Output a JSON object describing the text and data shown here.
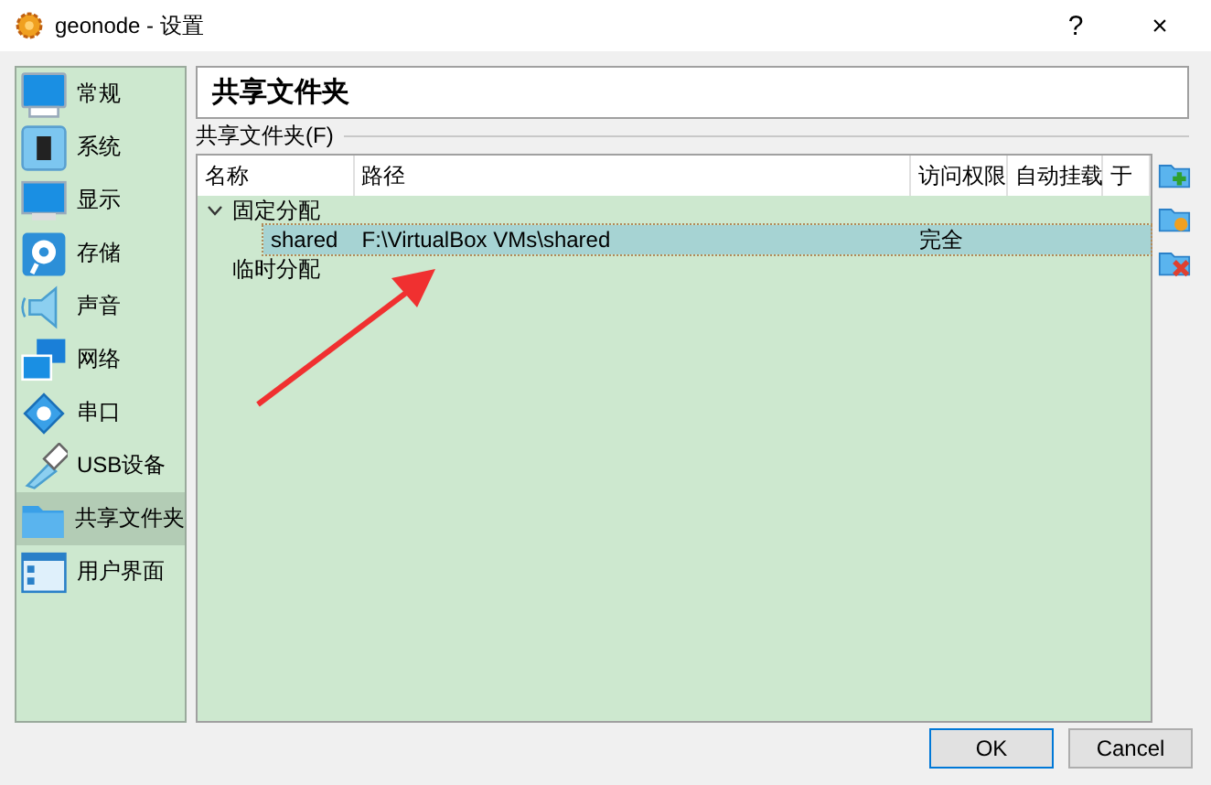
{
  "window": {
    "title": "geonode - 设置",
    "help": "?",
    "close": "×"
  },
  "sidebar": {
    "items": [
      {
        "label": "常规",
        "selected": false
      },
      {
        "label": "系统",
        "selected": false
      },
      {
        "label": "显示",
        "selected": false
      },
      {
        "label": "存储",
        "selected": false
      },
      {
        "label": "声音",
        "selected": false
      },
      {
        "label": "网络",
        "selected": false
      },
      {
        "label": "串口",
        "selected": false
      },
      {
        "label": "USB设备",
        "selected": false
      },
      {
        "label": "共享文件夹",
        "selected": true
      },
      {
        "label": "用户界面",
        "selected": false
      }
    ]
  },
  "page_title": "共享文件夹",
  "group_label": "共享文件夹(F)",
  "table": {
    "columns": [
      "名称",
      "路径",
      "访问权限",
      "自动挂载",
      "于"
    ],
    "groups": [
      {
        "label": "固定分配",
        "expanded": true,
        "rows": [
          {
            "cells": [
              "shared",
              "F:\\VirtualBox VMs\\shared",
              "完全",
              "",
              ""
            ],
            "selected": true
          }
        ]
      },
      {
        "label": "临时分配"
      }
    ]
  },
  "buttons": [
    {
      "label": "OK",
      "kind": "default"
    },
    {
      "label": "Cancel",
      "kind": "normal"
    }
  ]
}
